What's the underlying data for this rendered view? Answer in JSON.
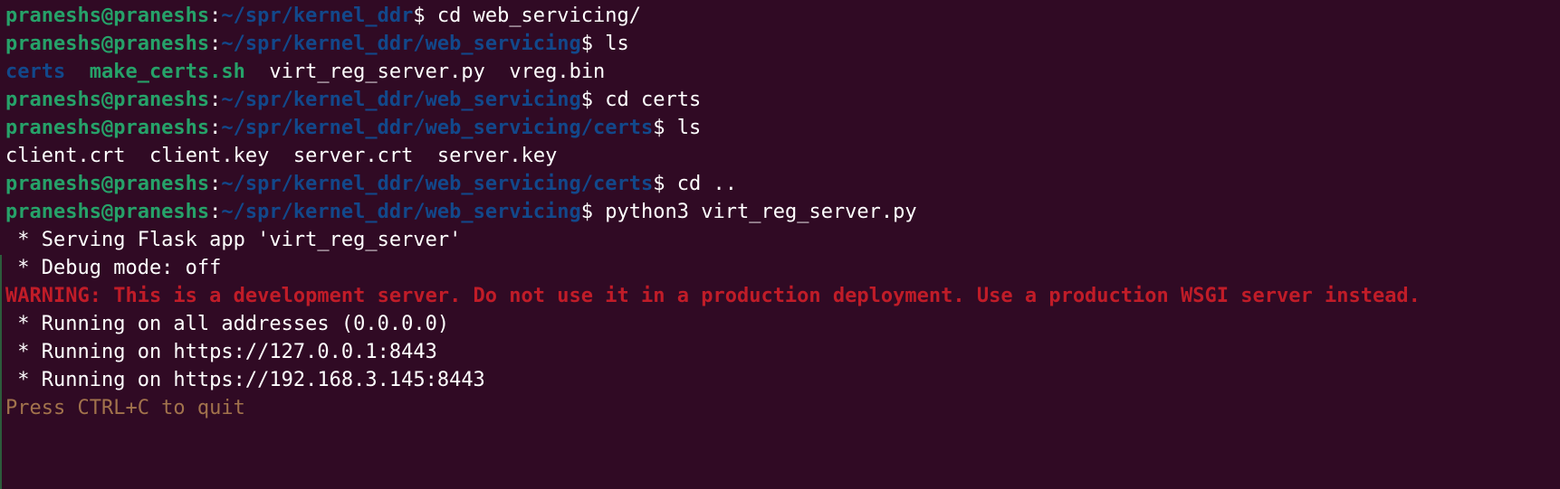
{
  "prompt": {
    "user": "praneshs@praneshs",
    "colon": ":",
    "dollar": "$ "
  },
  "lines": [
    {
      "path": "~/spr/kernel_ddr",
      "cmd": "cd web_servicing/"
    },
    {
      "path": "~/spr/kernel_ddr/web_servicing",
      "cmd": "ls"
    },
    {
      "ls": [
        "certs",
        "make_certs.sh",
        "virt_reg_server.py",
        "vreg.bin"
      ]
    },
    {
      "path": "~/spr/kernel_ddr/web_servicing",
      "cmd": "cd certs"
    },
    {
      "path": "~/spr/kernel_ddr/web_servicing/certs",
      "cmd": "ls"
    },
    {
      "ls": [
        "client.crt",
        "client.key",
        "server.crt",
        "server.key"
      ]
    },
    {
      "path": "~/spr/kernel_ddr/web_servicing/certs",
      "cmd": "cd .."
    },
    {
      "path": "~/spr/kernel_ddr/web_servicing",
      "cmd": "python3 virt_reg_server.py"
    },
    {
      "text": " * Serving Flask app 'virt_reg_server'"
    },
    {
      "text": " * Debug mode: off"
    },
    {
      "text": "WARNING: This is a development server. Do not use it in a production deployment. Use a production WSGI server instead."
    },
    {
      "text": " * Running on all addresses (0.0.0.0)"
    },
    {
      "text": " * Running on https://127.0.0.1:8443"
    },
    {
      "text": " * Running on https://192.168.3.145:8443"
    },
    {
      "text": "Press CTRL+C to quit"
    }
  ],
  "colors": {
    "background": "#300a24",
    "user": "#26a269",
    "path": "#12488b",
    "directory": "#12488b",
    "executable": "#26a269",
    "warning": "#c01c28",
    "hint": "#a2734c"
  }
}
